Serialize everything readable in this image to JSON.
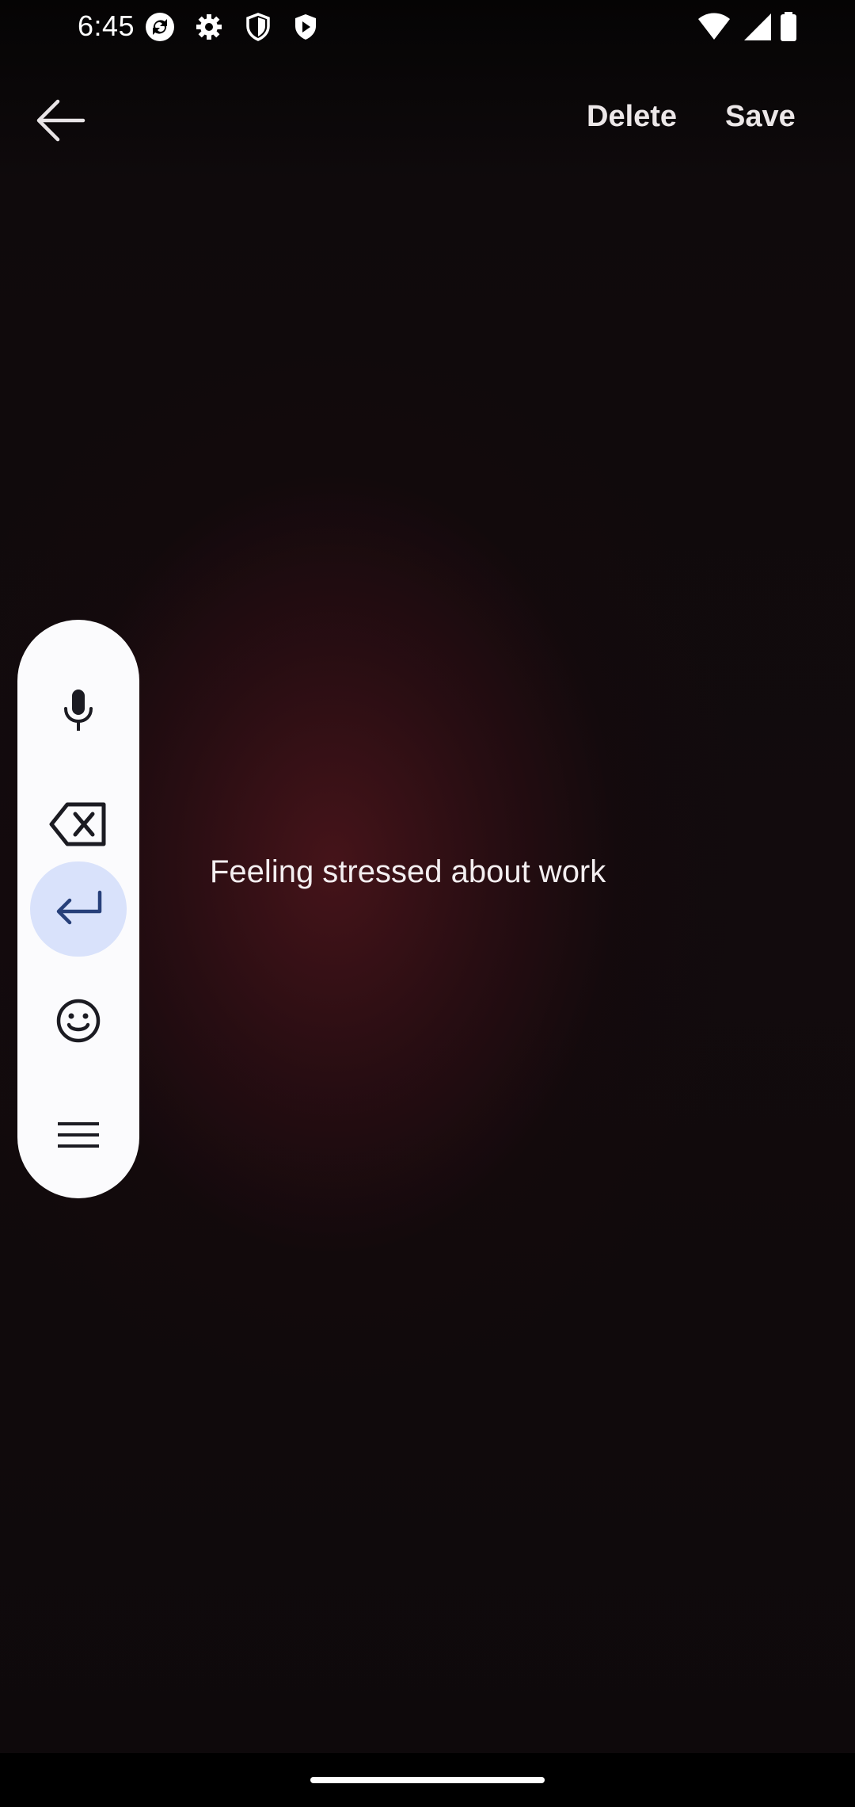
{
  "status_bar": {
    "time": "6:45",
    "left_icons": [
      "sync-icon",
      "gear-icon",
      "shield-icon",
      "play-shield-icon"
    ],
    "right_icons": [
      "wifi-icon",
      "signal-icon",
      "battery-icon"
    ]
  },
  "app_bar": {
    "back_icon": "arrow-left-icon",
    "delete_label": "Delete",
    "save_label": "Save"
  },
  "editor": {
    "text": "Feeling stressed about work"
  },
  "toolbar": {
    "items": [
      {
        "icon": "microphone-icon",
        "active": false
      },
      {
        "icon": "backspace-icon",
        "active": false
      },
      {
        "icon": "enter-icon",
        "active": true
      },
      {
        "icon": "emoji-icon",
        "active": false
      },
      {
        "icon": "menu-icon",
        "active": false
      }
    ]
  },
  "colors": {
    "accent": "#d9e2fb",
    "panel": "#fbfbfd",
    "icon_dark": "#1b1b22",
    "icon_active": "#27407a",
    "background_glow": "#48141a"
  }
}
